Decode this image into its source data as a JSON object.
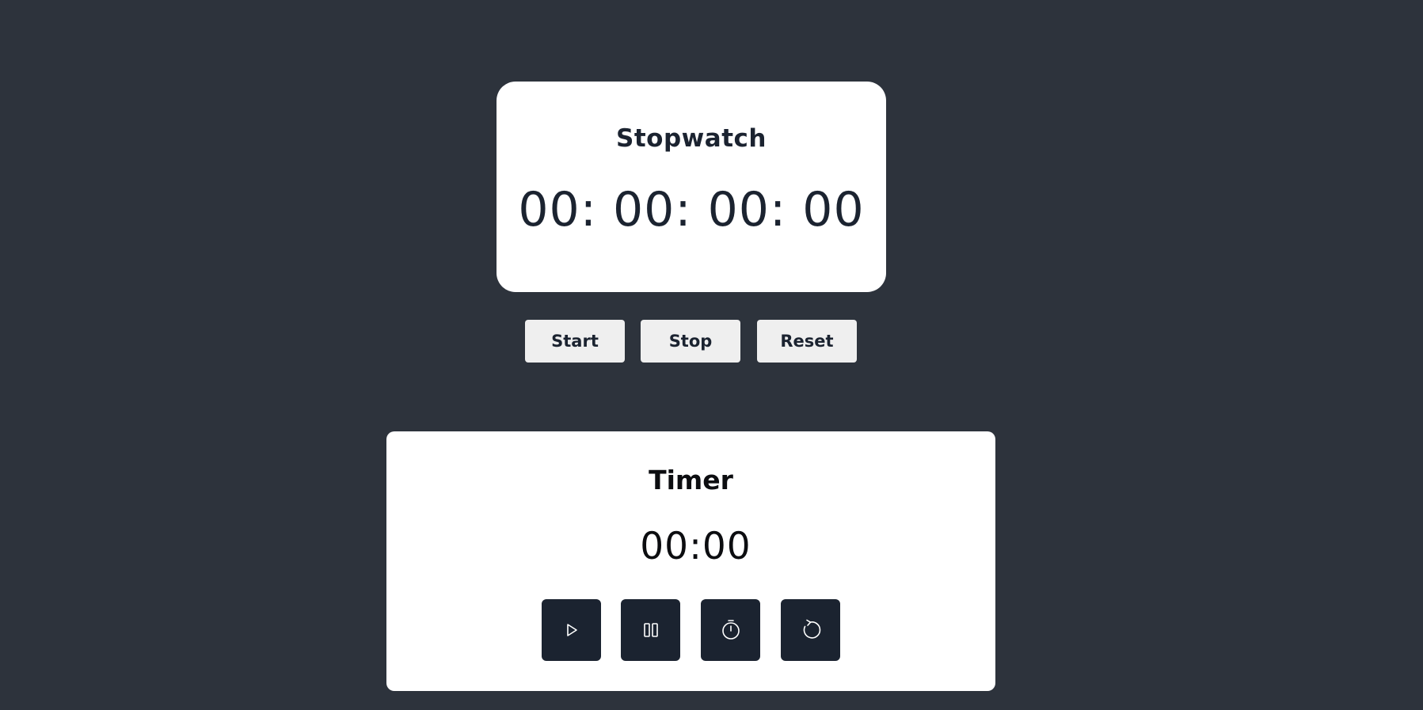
{
  "stopwatch": {
    "title": "Stopwatch",
    "display": "00: 00: 00: 00",
    "buttons": {
      "start": "Start",
      "stop": "Stop",
      "reset": "Reset"
    }
  },
  "timer": {
    "title": "Timer",
    "display": "00:00",
    "buttons": [
      {
        "icon": "play-icon"
      },
      {
        "icon": "pause-icon"
      },
      {
        "icon": "stopwatch-icon"
      },
      {
        "icon": "reset-icon"
      }
    ]
  },
  "colors": {
    "background": "#2d333c",
    "card": "#ffffff",
    "dark_button": "#1b2330",
    "light_button": "#efefef",
    "text_dark": "#1b2330"
  }
}
